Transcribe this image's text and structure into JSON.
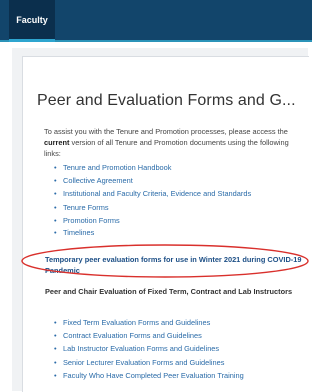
{
  "header": {
    "tab_label": "Faculty"
  },
  "page": {
    "title": "Peer and Evaluation Forms and G...",
    "intro_before": "To assist you with the Tenure and Promotion processes, please access the ",
    "intro_bold": "current",
    "intro_after": " version of all Tenure and Promotion documents using the following links:"
  },
  "links_primary": [
    "Tenure and Promotion Handbook",
    "Collective Agreement",
    "Institutional and Faculty Criteria, Evidence and Standards",
    "Tenure Forms",
    "Promotion Forms",
    "Timelines"
  ],
  "temporary_link": "Temporary peer evaluation forms for use in Winter 2021 during COVID-19 Pandemic",
  "subheading": "Peer and Chair Evaluation of Fixed Term, Contract and Lab Instructors",
  "links_secondary": [
    "Fixed Term Evaluation Forms and Guidelines",
    "Contract Evaluation Forms and Guidelines",
    "Lab Instructor Evaluation Forms and Guidelines",
    "Senior Lecturer Evaluation Forms and Guidelines",
    "Faculty Who Have Completed Peer Evaluation Training"
  ],
  "colors": {
    "header_bg": "#12456b",
    "tab_active": "#0b2f4d",
    "link": "#2a6ba8",
    "annotation_oval": "#d9302c"
  }
}
